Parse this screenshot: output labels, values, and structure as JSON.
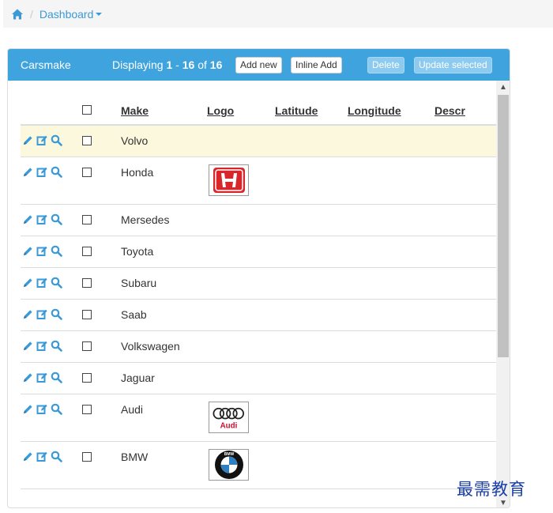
{
  "breadcrumb": {
    "home_icon": "home-icon",
    "separator": "/",
    "current": "Dashboard"
  },
  "panel": {
    "title": "Carsmake",
    "displaying_prefix": "Displaying",
    "range_start": "1",
    "range_dash": " - ",
    "range_end": "16",
    "of_text": " of ",
    "total": "16",
    "buttons": {
      "add_new": "Add new",
      "inline_add": "Inline Add",
      "delete": "Delete",
      "update_selected": "Update selected"
    }
  },
  "table": {
    "columns": {
      "make": "Make",
      "logo": "Logo",
      "latitude": "Latitude",
      "longitude": "Longitude",
      "descr": "Descr"
    },
    "rows": [
      {
        "make": "Volvo",
        "logo": null
      },
      {
        "make": "Honda",
        "logo": "honda-logo"
      },
      {
        "make": "Mersedes",
        "logo": null
      },
      {
        "make": "Toyota",
        "logo": null
      },
      {
        "make": "Subaru",
        "logo": null
      },
      {
        "make": "Saab",
        "logo": null
      },
      {
        "make": "Volkswagen",
        "logo": null
      },
      {
        "make": "Jaguar",
        "logo": null
      },
      {
        "make": "Audi",
        "logo": "audi-logo",
        "logo_text": "Audi"
      },
      {
        "make": "BMW",
        "logo": "bmw-logo",
        "logo_text": "BMW"
      }
    ]
  },
  "colors": {
    "header_bg": "#3fa4de",
    "link": "#3a9ad9",
    "highlight_row": "#fcf8dd",
    "icon": "#3a9ad9"
  },
  "watermark": "最需教育"
}
